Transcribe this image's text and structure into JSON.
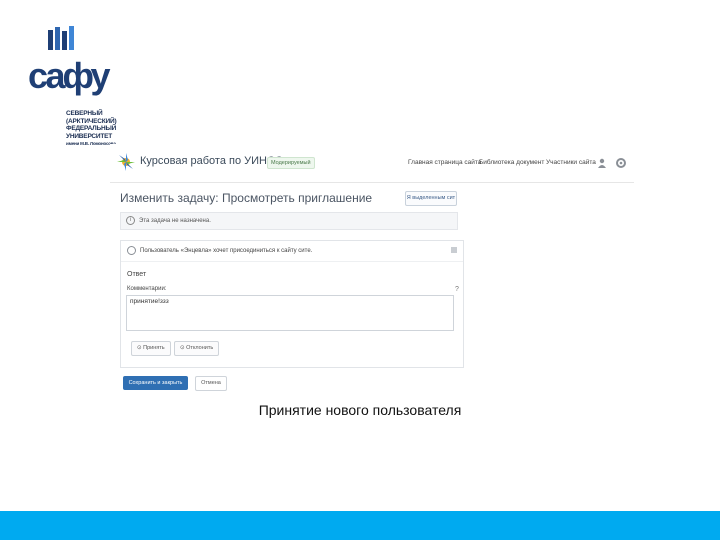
{
  "logo": {
    "wordmark": "сафу",
    "lines": [
      "СЕВЕРНЫЙ",
      "(АРКТИЧЕСКИЙ)",
      "ФЕДЕРАЛЬНЫЙ",
      "УНИВЕРСИТЕТ",
      "имени М.В. Ломоносова"
    ]
  },
  "screenshot": {
    "site_title": "Курсовая работа по УИНСС",
    "badge": "Модерируемый",
    "nav": [
      "Главная страница сайта",
      "Библиотека документ",
      "Участники сайта"
    ],
    "page_title": "Изменить задачу: Просмотреть приглашение",
    "view_button": "Я выделенным сит",
    "notice": "Эта задача не назначена.",
    "card": {
      "header": "Пользователь «Энцевла» хочет присоединиться к сайту сите.",
      "answer_label": "Ответ",
      "comments_label": "Комментарии:",
      "comments_value": "принятие!ззз",
      "accept_button": "Принять",
      "reject_button": "Отклонить"
    },
    "save_button": "Сохранить и закрыть",
    "cancel_button": "Отмена"
  },
  "caption": "Принятие нового пользователя",
  "colors": {
    "bottom_bar": "#00aaf0",
    "primary_button": "#2f6fb3",
    "logo": "#1f3f75"
  }
}
